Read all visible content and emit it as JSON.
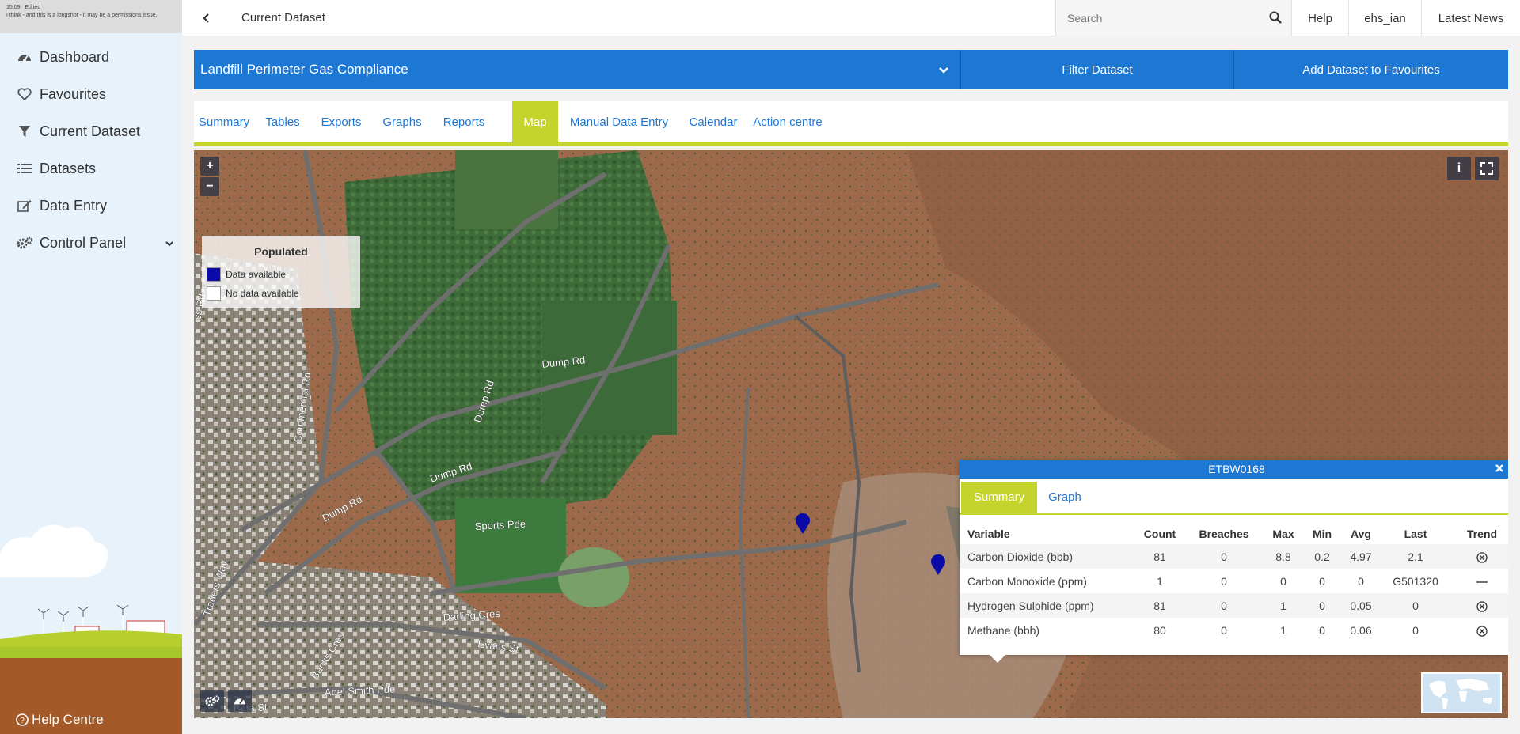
{
  "note": {
    "time": "15:09",
    "status": "Edited",
    "message": "I think - and this is a longshot - it may be a permissions issue."
  },
  "sidebar": {
    "items": [
      {
        "label": "Dashboard",
        "icon": "dashboard-icon"
      },
      {
        "label": "Favourites",
        "icon": "heart-icon"
      },
      {
        "label": "Current Dataset",
        "icon": "filter-icon"
      },
      {
        "label": "Datasets",
        "icon": "list-icon"
      },
      {
        "label": "Data Entry",
        "icon": "edit-icon"
      },
      {
        "label": "Control Panel",
        "icon": "cogs-icon"
      }
    ],
    "help_label": "Help Centre"
  },
  "topbar": {
    "crumb": "Current Dataset",
    "search_placeholder": "Search",
    "links": [
      "Help",
      "ehs_ian",
      "Latest News"
    ]
  },
  "dataset": {
    "title": "Landfill Perimeter Gas Compliance",
    "filter_label": "Filter Dataset",
    "favourite_label": "Add Dataset to Favourites"
  },
  "tabs": [
    "Summary",
    "Tables",
    "Exports",
    "Graphs",
    "Reports",
    "Map",
    "Manual Data Entry",
    "Calendar",
    "Action centre"
  ],
  "active_tab": "Map",
  "map": {
    "zoom_in": "+",
    "zoom_out": "−",
    "info_label": "i",
    "legend": {
      "title": "Populated",
      "items": [
        {
          "label": "Data available",
          "color": "#0a0aa8"
        },
        {
          "label": "No data available",
          "color": "#ffffff"
        }
      ]
    },
    "streets": [
      "Dump Rd",
      "Dump Rd",
      "Dump Rd",
      "Dump Rd",
      "Commercial Rd",
      "Sports Pde",
      "Darling Cres",
      "Banks Cres",
      "Evans St",
      "Abel Smith Pde",
      "Beta St",
      "Traders Way",
      "ss Rd"
    ]
  },
  "popup": {
    "title": "ETBW0168",
    "tabs": [
      "Summary",
      "Graph"
    ],
    "active_tab": "Summary",
    "columns": [
      "Variable",
      "Count",
      "Breaches",
      "Max",
      "Min",
      "Avg",
      "Last",
      "Trend"
    ],
    "rows": [
      {
        "variable": "Carbon Dioxide (bbb)",
        "count": "81",
        "breaches": "0",
        "max": "8.8",
        "min": "0.2",
        "avg": "4.97",
        "last": "2.1",
        "trend": "circle-x"
      },
      {
        "variable": "Carbon Monoxide (ppm)",
        "count": "1",
        "breaches": "0",
        "max": "0",
        "min": "0",
        "avg": "0",
        "last": "G501320",
        "trend": "dash"
      },
      {
        "variable": "Hydrogen Sulphide (ppm)",
        "count": "81",
        "breaches": "0",
        "max": "1",
        "min": "0",
        "avg": "0.05",
        "last": "0",
        "trend": "circle-x"
      },
      {
        "variable": "Methane (bbb)",
        "count": "80",
        "breaches": "0",
        "max": "1",
        "min": "0",
        "avg": "0.06",
        "last": "0",
        "trend": "circle-x"
      }
    ]
  },
  "colors": {
    "primary": "#1d78d4",
    "accent": "#c5d42c",
    "marker": "#0a0aa8"
  }
}
